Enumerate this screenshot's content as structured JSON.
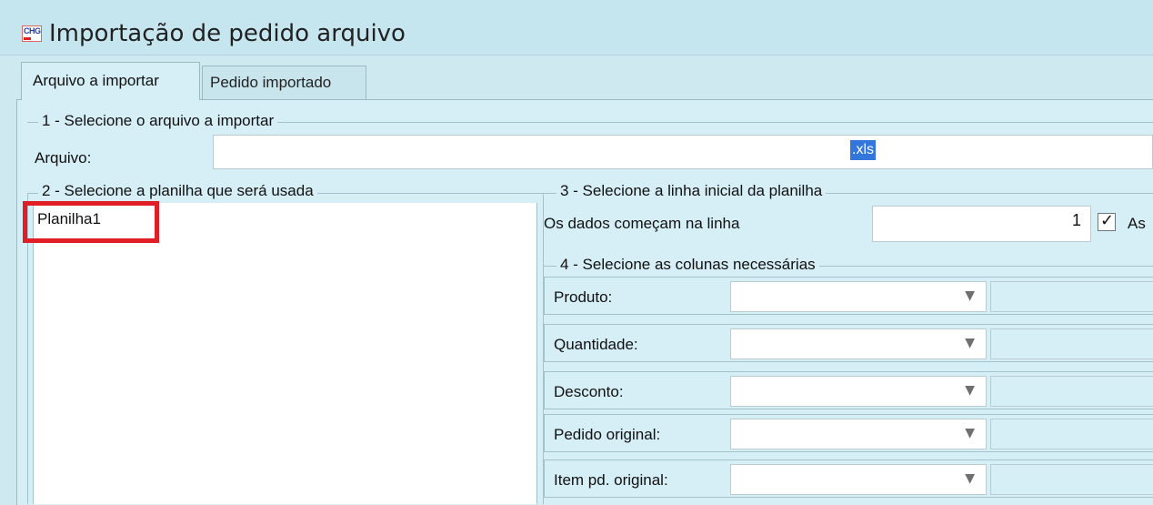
{
  "window": {
    "title": "Importação de pedido arquivo",
    "icon": "chg-app-icon",
    "icon_text": "CHG"
  },
  "tabs": [
    {
      "label": "Arquivo a importar",
      "active": true
    },
    {
      "label": "Pedido importado",
      "active": false
    }
  ],
  "section1": {
    "legend": "1 - Selecione o arquivo a importar",
    "file_label": "Arquivo:",
    "file_value": ".xls"
  },
  "section2": {
    "legend": "2 - Selecione a planilha que será usada",
    "items": [
      "Planilha1"
    ]
  },
  "section3": {
    "legend": "3 - Selecione a linha inicial da planilha",
    "start_label": "Os dados começam na linha",
    "start_value": "1",
    "checkbox_label": "As",
    "checkbox_checked": true
  },
  "section4": {
    "legend": "4 - Selecione as colunas necessárias",
    "rows": [
      {
        "label": "Produto:",
        "value": ""
      },
      {
        "label": "Quantidade:",
        "value": ""
      },
      {
        "label": "Desconto:",
        "value": ""
      },
      {
        "label": "Pedido original:",
        "value": ""
      },
      {
        "label": "Item pd. original:",
        "value": ""
      }
    ]
  },
  "colors": {
    "background": "#cfe9f1",
    "highlight_border": "#e11d26",
    "selection": "#3377dd"
  }
}
